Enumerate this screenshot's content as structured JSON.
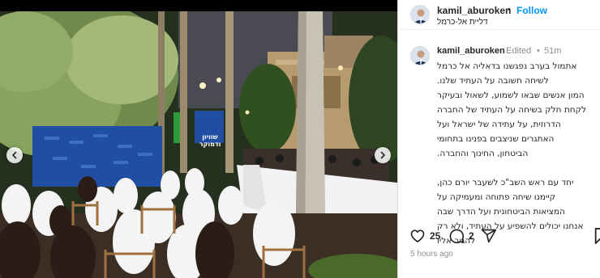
{
  "photo": {
    "banner_line1": "שוויון",
    "banner_line2": "ודמוקר"
  },
  "post": {
    "username": "kamil_aburoken",
    "separator": "•",
    "follow_label": "Follow",
    "location": "דליית אל-כרמל",
    "more_icon": "more-horizontal-icon"
  },
  "comment": {
    "username": "kamil_aburoken",
    "edited_label": "Edited",
    "separator": "•",
    "time": "51m",
    "paragraphs": [
      [
        "אתמול בערב נפגשנו בדאליה אל כרמל",
        "לשיחה חשובה על העתיד שלנו.",
        "המון אנשים שבאו לשמוע, לשאול ובעיקר",
        "לקחת חלק בשיחה על העתיד של החברה",
        "הדרוזית, על עתידה של ישראל ועל",
        "האתגרים שניצבים בפנינו בתחומי",
        "הביטחון, החינוך והחברה."
      ],
      [
        "יחד עם ראש השב\"כ לשעבר יורם כהן,",
        "קיימנו שיחה פתוחה ומעמיקה על",
        "המציאות הביטחונית ועל הדרך שבה",
        "אנחנו יכולים להשפיע על העתיד, ולא רק",
        "להגיב אליו"
      ]
    ]
  },
  "actions": {
    "like_icon": "heart-icon",
    "likes": "25",
    "comment_icon": "comment-icon",
    "comments": "2",
    "share_icon": "share-icon",
    "save_icon": "bookmark-icon"
  },
  "timestamp": "5 hours ago",
  "colors": {
    "follow": "#0095f6",
    "banner": "#1f4ea3",
    "muted": "#8e8e8e"
  }
}
